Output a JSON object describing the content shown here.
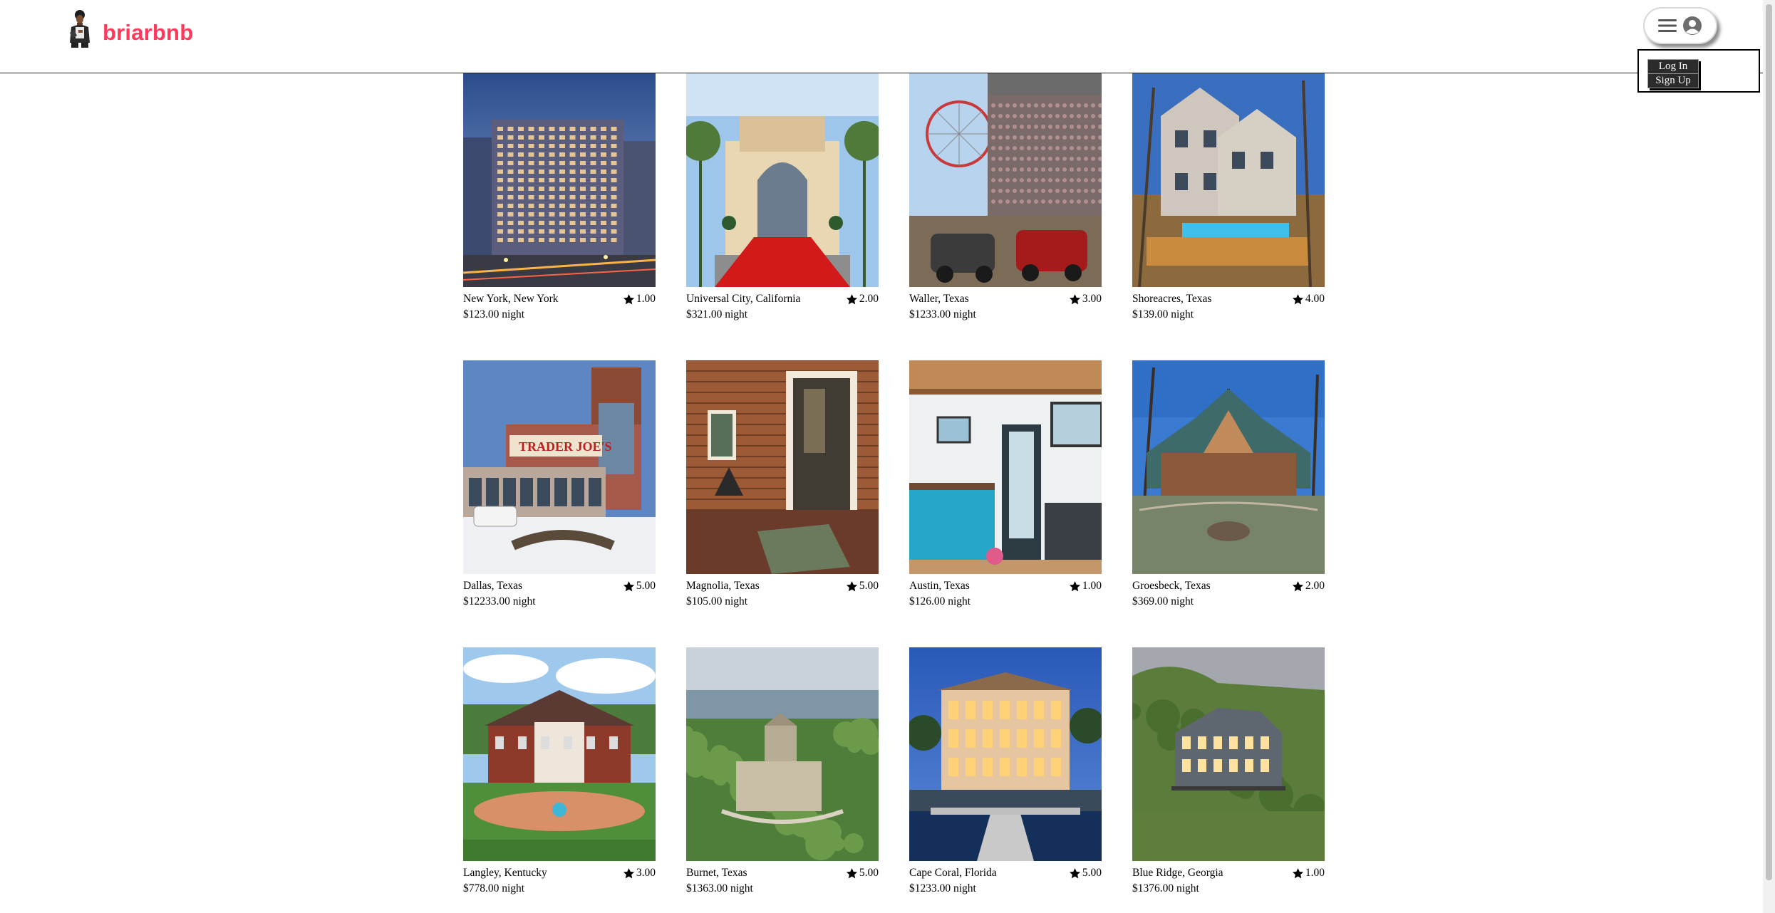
{
  "brand": {
    "name": "briarbnb",
    "color": "#ff385c"
  },
  "profile_menu": {
    "menu_icon": "hamburger-icon",
    "user_icon": "user-circle-icon",
    "items": [
      {
        "label": "Log In"
      },
      {
        "label": "Sign Up"
      }
    ]
  },
  "listings": [
    {
      "location": "New York, New York",
      "rating": "1.00",
      "price": "$123.00 night",
      "image": "city-hotel"
    },
    {
      "location": "Universal City, California",
      "rating": "2.00",
      "price": "$321.00 night",
      "image": "theme-park-arch"
    },
    {
      "location": "Waller, Texas",
      "rating": "3.00",
      "price": "$1233.00 night",
      "image": "fairground-derby"
    },
    {
      "location": "Shoreacres, Texas",
      "rating": "4.00",
      "price": "$139.00 night",
      "image": "white-house-pool"
    },
    {
      "location": "Dallas, Texas",
      "rating": "5.00",
      "price": "$12233.00 night",
      "image": "grocery-store"
    },
    {
      "location": "Magnolia, Texas",
      "rating": "5.00",
      "price": "$105.00 night",
      "image": "tiny-cabin-door"
    },
    {
      "location": "Austin, Texas",
      "rating": "1.00",
      "price": "$126.00 night",
      "image": "tiny-kitchen"
    },
    {
      "location": "Groesbeck, Texas",
      "rating": "2.00",
      "price": "$369.00 night",
      "image": "log-cabin"
    },
    {
      "location": "Langley, Kentucky",
      "rating": "3.00",
      "price": "$778.00 night",
      "image": "brick-mansion"
    },
    {
      "location": "Burnet, Texas",
      "rating": "5.00",
      "price": "$1363.00 night",
      "image": "stone-castle"
    },
    {
      "location": "Cape Coral, Florida",
      "rating": "5.00",
      "price": "$1233.00 night",
      "image": "waterfront-villa"
    },
    {
      "location": "Blue Ridge, Georgia",
      "rating": "1.00",
      "price": "$1376.00 night",
      "image": "mountain-lodge"
    }
  ]
}
